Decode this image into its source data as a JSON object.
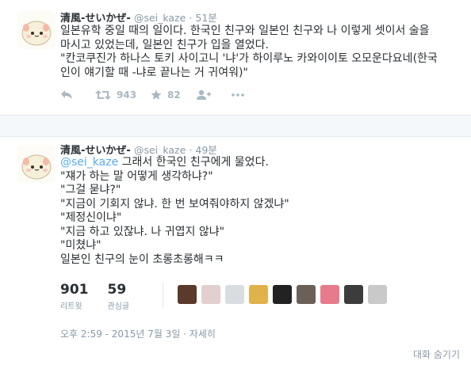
{
  "tweet1": {
    "fullname": "清風-せいかぜ-",
    "handle": "@sei_kaze",
    "time": "51분",
    "lines": [
      "일본유학 중일 때의 일이다. 한국인 친구와 일본인 친구와 나 이렇게 셋이서 술을",
      "마시고 있었는데, 일본인 친구가 입을 열었다.",
      "\"칸코쿠진가 하나스 토키 사이고니 '냐'가 하이루노 카와이이토 오모운다요네(한국",
      "인이 얘기할 때 -냐로 끝나는 거 귀여워)\""
    ],
    "retweet_count": "943",
    "favorite_count": "82"
  },
  "tweet2": {
    "fullname": "清風-せいかぜ-",
    "handle": "@sei_kaze",
    "time": "49분",
    "mention": "@sei_kaze",
    "first_line_rest": " 그래서 한국인 친구에게 물었다.",
    "lines": [
      "\"쟤가 하는 말 어떻게 생각하냐?\"",
      "\"그걸 묻냐?\"",
      "\"지금이 기회지 않냐. 한 번 보여줘야하지 않겠냐\"",
      "\"제정신이냐\"",
      "\"지금 하고 있잖냐. 나 귀엽지 않냐\"",
      "\"미쳤냐\"",
      "일본인 친구의 눈이 초롱초롱해ㅋㅋ"
    ],
    "retweets": {
      "count": "901",
      "label": "리트윗"
    },
    "favorites": {
      "count": "59",
      "label": "관심글"
    },
    "datetime": "오후 2:59 - 2015년 7월 3일 · 자세히",
    "hide_conversation": "대화 숨기기"
  },
  "colors": {
    "accent": "#55acee",
    "muted": "#8899a6",
    "icon": "#aab8c2",
    "text": "#292f33"
  },
  "icons": [
    "reply-icon",
    "retweet-icon",
    "favorite-icon",
    "follow-icon",
    "more-icon"
  ]
}
